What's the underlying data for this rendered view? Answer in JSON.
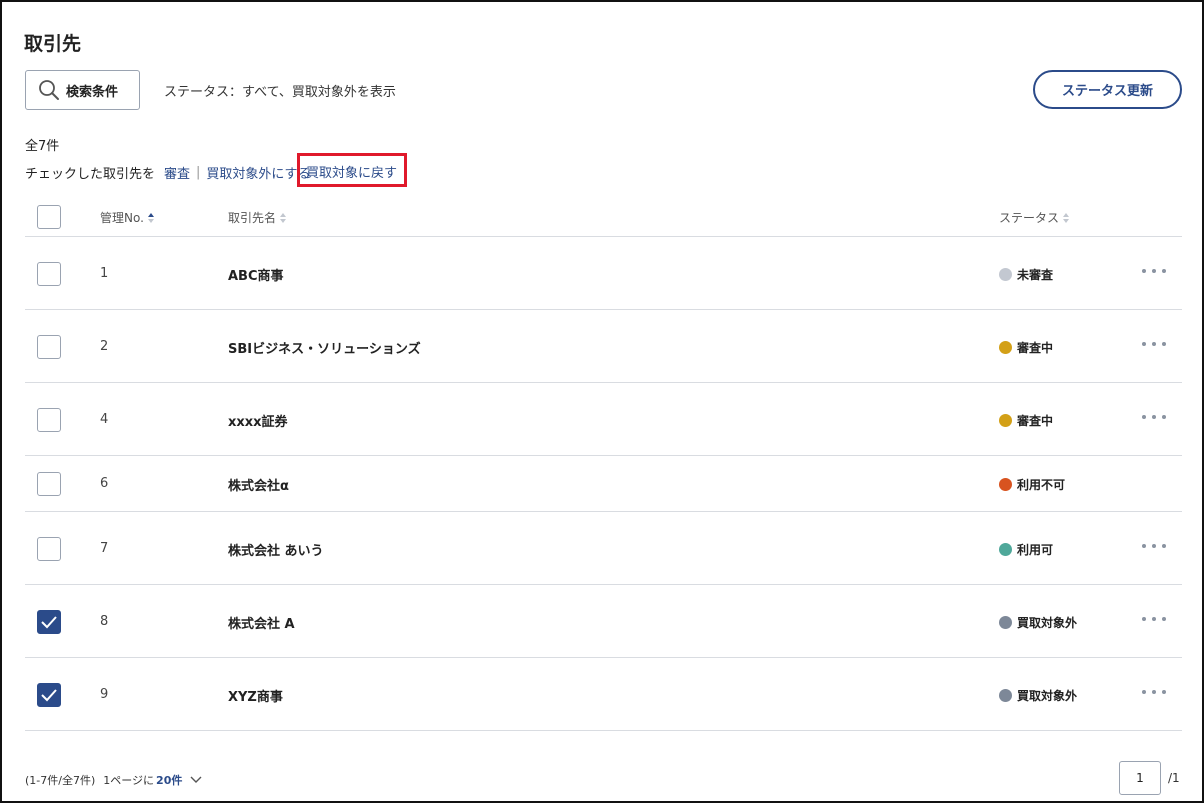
{
  "page": {
    "title": "取引先"
  },
  "toolbar": {
    "search_label": "検索条件",
    "filter_text": "ステータス：すべて、買取対象外を表示",
    "status_update_label": "ステータス更新"
  },
  "summary": {
    "total": "全7件"
  },
  "bulk_actions": {
    "prefix": "チェックした取引先を",
    "review": "審査",
    "exclude": "買取対象外にする",
    "restore": "買取対象に戻す"
  },
  "table": {
    "headers": {
      "id": "管理No.",
      "name": "取引先名",
      "status": "ステータス"
    },
    "rows": [
      {
        "id": "1",
        "name": "ABC商事",
        "status": "未審査",
        "status_color": "#c3c8d1",
        "checked": false,
        "has_menu": true
      },
      {
        "id": "2",
        "name": "SBIビジネス・ソリューションズ",
        "status": "審査中",
        "status_color": "#d3a017",
        "checked": false,
        "has_menu": true
      },
      {
        "id": "4",
        "name": "xxxx証券",
        "status": "審査中",
        "status_color": "#d3a017",
        "checked": false,
        "has_menu": true
      },
      {
        "id": "6",
        "name": "株式会社α",
        "status": "利用不可",
        "status_color": "#d8531f",
        "checked": false,
        "has_menu": false
      },
      {
        "id": "7",
        "name": "株式会社 あいう",
        "status": "利用可",
        "status_color": "#4fa89a",
        "checked": false,
        "has_menu": true
      },
      {
        "id": "8",
        "name": "株式会社 A",
        "status": "買取対象外",
        "status_color": "#7d8898",
        "checked": true,
        "has_menu": true
      },
      {
        "id": "9",
        "name": "XYZ商事",
        "status": "買取対象外",
        "status_color": "#7d8898",
        "checked": true,
        "has_menu": true
      }
    ]
  },
  "footer": {
    "range": "(1-7件/全7件)",
    "per_page_prefix": "1ページに",
    "per_page_value": "20件",
    "page_current": "1",
    "page_total": "/1"
  }
}
